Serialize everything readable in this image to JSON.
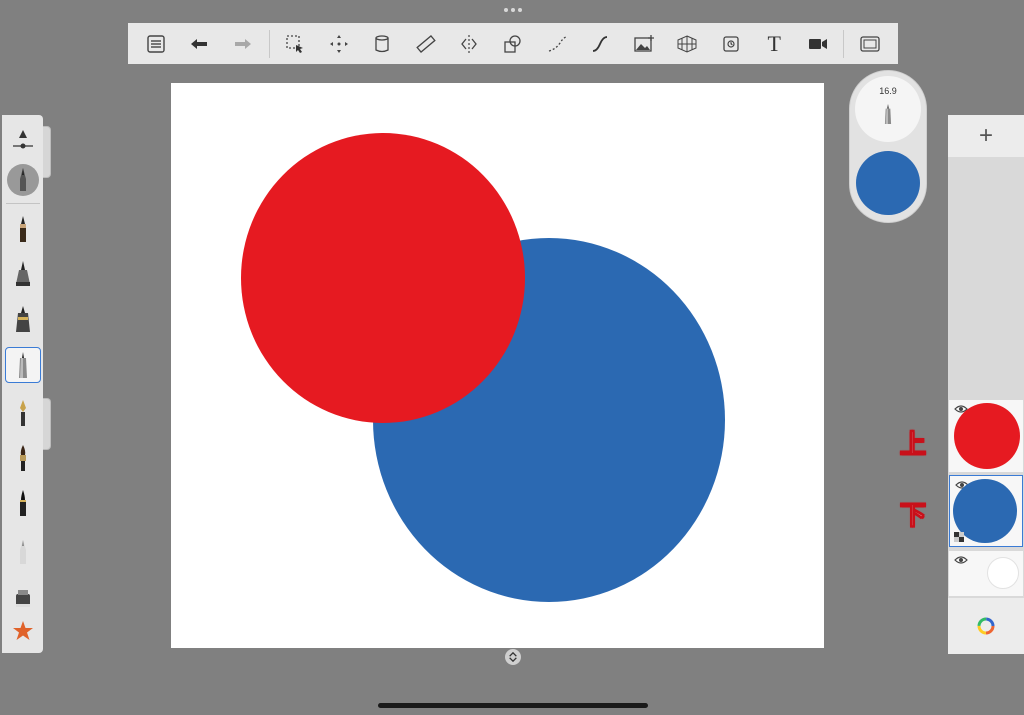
{
  "toolbar": {
    "items": [
      {
        "icon": "list-icon"
      },
      {
        "icon": "undo-icon"
      },
      {
        "icon": "redo-icon"
      },
      {
        "icon": "selection-icon"
      },
      {
        "icon": "transform-icon"
      },
      {
        "icon": "fill-icon"
      },
      {
        "icon": "ruler-icon"
      },
      {
        "icon": "symmetry-icon"
      },
      {
        "icon": "shape-icon"
      },
      {
        "icon": "stroke-icon"
      },
      {
        "icon": "steady-stroke-icon"
      },
      {
        "icon": "image-import-icon"
      },
      {
        "icon": "perspective-icon"
      },
      {
        "icon": "flipbook-icon"
      },
      {
        "icon": "text-icon",
        "label": "T"
      },
      {
        "icon": "time-lapse-icon"
      },
      {
        "icon": "fullscreen-icon"
      }
    ]
  },
  "brush_puck": {
    "size": "16.9",
    "color": "#2b69b2"
  },
  "brush_panel": {
    "selected": "airbrush",
    "brushes": [
      "pencil",
      "marker",
      "technical-pen",
      "airbrush",
      "ink-pen",
      "paintbrush",
      "brush-pen",
      "eraser",
      "smudge",
      "favorites"
    ]
  },
  "canvas": {
    "background": "#ffffff",
    "circles": [
      {
        "name": "blue",
        "color": "#2b69b2"
      },
      {
        "name": "red",
        "color": "#e61a21"
      }
    ]
  },
  "layers": [
    {
      "name": "upper",
      "color": "#e61a21",
      "visible": true
    },
    {
      "name": "lower",
      "color": "#2b69b2",
      "visible": true,
      "selected": true
    },
    {
      "name": "background",
      "color": "#ffffff",
      "visible": true
    }
  ],
  "annotations": {
    "upper": "上",
    "lower": "下"
  },
  "layer_panel": {
    "add_label": "+"
  }
}
